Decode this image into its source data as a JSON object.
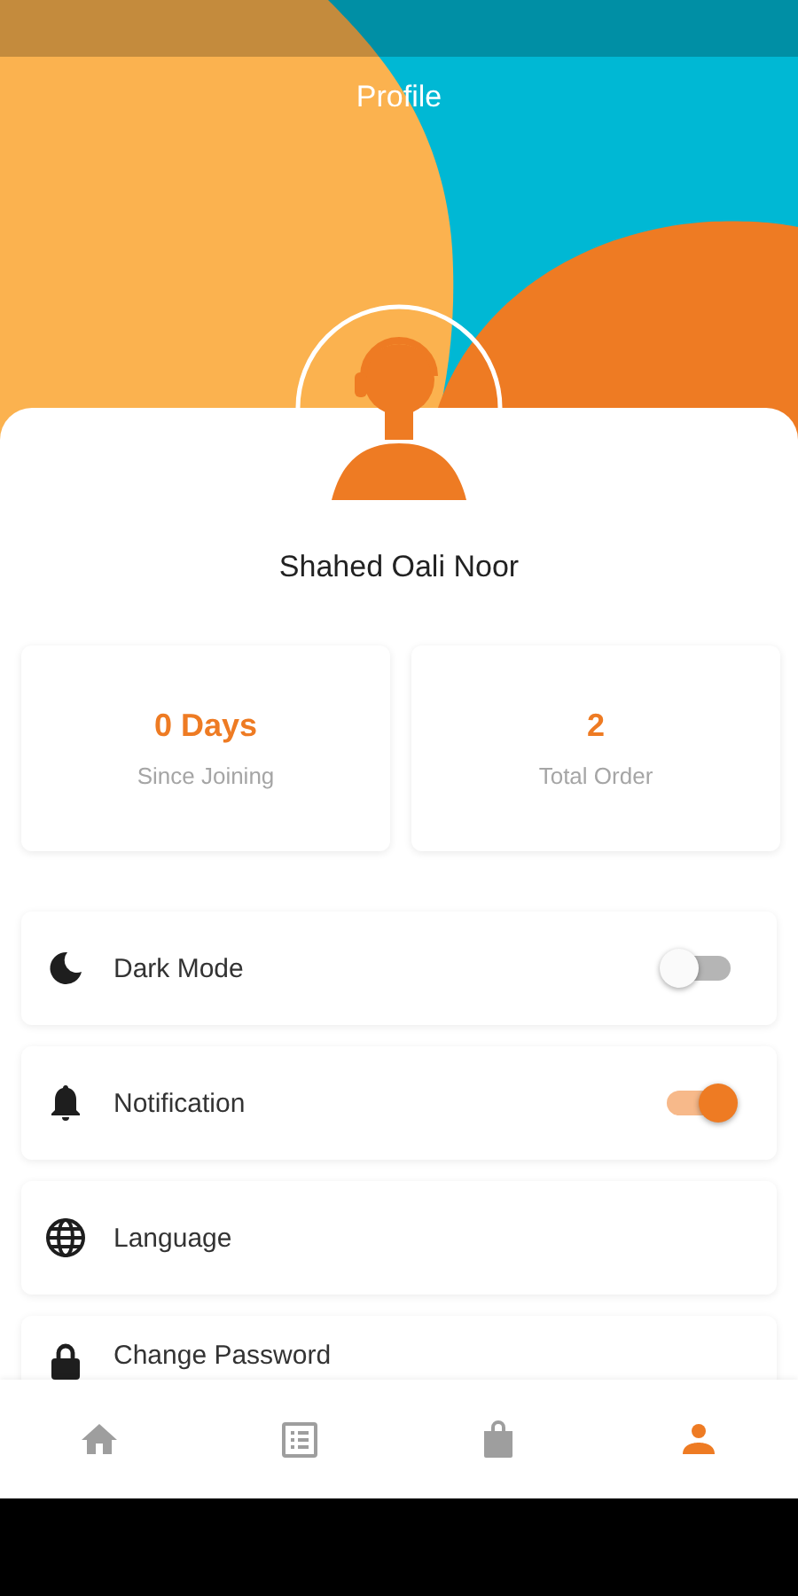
{
  "header": {
    "title": "Profile"
  },
  "profile": {
    "name": "Shahed Oali Noor"
  },
  "stats": [
    {
      "value": "0 Days",
      "label": "Since Joining"
    },
    {
      "value": "2",
      "label": "Total Order"
    }
  ],
  "settings": [
    {
      "kind": "toggle",
      "label": "Dark Mode",
      "on": false
    },
    {
      "kind": "toggle",
      "label": "Notification",
      "on": true
    },
    {
      "kind": "link",
      "label": "Language"
    },
    {
      "kind": "link",
      "label": "Change Password"
    }
  ],
  "nav": [
    {
      "selected": false
    },
    {
      "selected": false
    },
    {
      "selected": false
    },
    {
      "selected": true
    }
  ]
}
